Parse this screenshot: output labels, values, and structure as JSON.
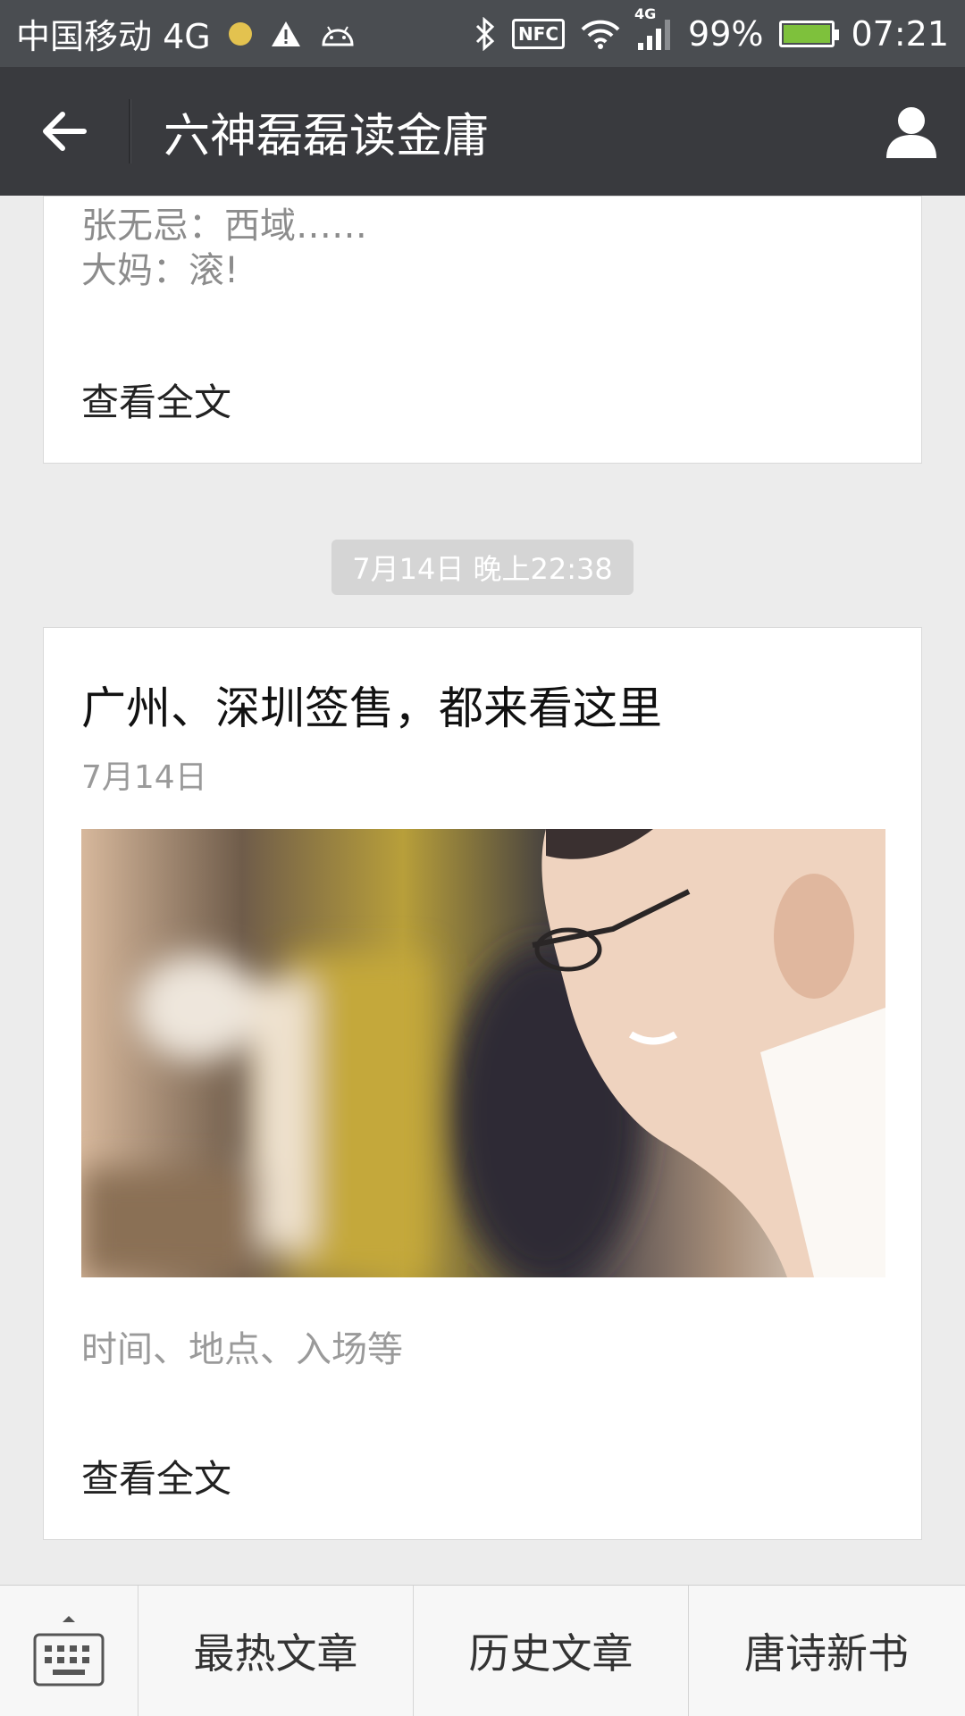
{
  "status_bar": {
    "carrier": "中国移动 4G",
    "signal_label": "4G",
    "battery": "99%",
    "time": "07:21"
  },
  "header": {
    "title": "六神磊磊读金庸"
  },
  "messages": [
    {
      "lines": [
        "张无忌：西域……",
        "大妈：滚!"
      ],
      "read_more": "查看全文"
    },
    {
      "timestamp": "7月14日 晚上22:38",
      "title": "广州、深圳签售，都来看这里",
      "date": "7月14日",
      "summary": "时间、地点、入场等",
      "read_more": "查看全文"
    }
  ],
  "bottom_menu": {
    "items": [
      "最热文章",
      "历史文章",
      "唐诗新书"
    ]
  },
  "colors": {
    "titlebar": "#393a3e",
    "statusbar": "#4a4d51",
    "background": "#ececec"
  }
}
